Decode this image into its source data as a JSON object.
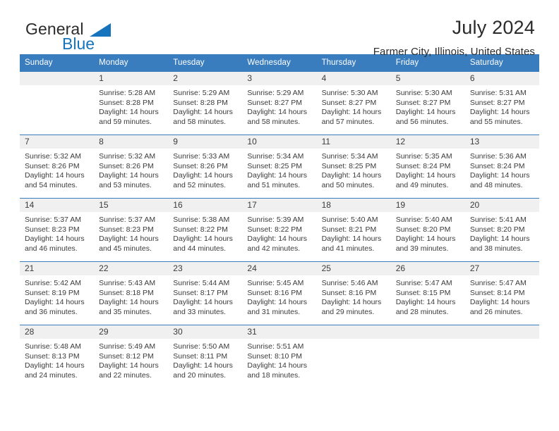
{
  "brand": {
    "name_part1": "General",
    "name_part2": "Blue",
    "accent_color": "#1574bb"
  },
  "header": {
    "title": "July 2024",
    "location": "Farmer City, Illinois, United States"
  },
  "theme": {
    "header_row_color": "#3a7dbf",
    "daynum_band_color": "#f0f0f0",
    "text_color": "#3b3b3b"
  },
  "weekday_headers": [
    "Sunday",
    "Monday",
    "Tuesday",
    "Wednesday",
    "Thursday",
    "Friday",
    "Saturday"
  ],
  "weeks": [
    [
      {
        "day": "",
        "sunrise": "",
        "sunset": "",
        "daylight_line1": "",
        "daylight_line2": ""
      },
      {
        "day": "1",
        "sunrise": "Sunrise: 5:28 AM",
        "sunset": "Sunset: 8:28 PM",
        "daylight_line1": "Daylight: 14 hours",
        "daylight_line2": "and 59 minutes."
      },
      {
        "day": "2",
        "sunrise": "Sunrise: 5:29 AM",
        "sunset": "Sunset: 8:28 PM",
        "daylight_line1": "Daylight: 14 hours",
        "daylight_line2": "and 58 minutes."
      },
      {
        "day": "3",
        "sunrise": "Sunrise: 5:29 AM",
        "sunset": "Sunset: 8:27 PM",
        "daylight_line1": "Daylight: 14 hours",
        "daylight_line2": "and 58 minutes."
      },
      {
        "day": "4",
        "sunrise": "Sunrise: 5:30 AM",
        "sunset": "Sunset: 8:27 PM",
        "daylight_line1": "Daylight: 14 hours",
        "daylight_line2": "and 57 minutes."
      },
      {
        "day": "5",
        "sunrise": "Sunrise: 5:30 AM",
        "sunset": "Sunset: 8:27 PM",
        "daylight_line1": "Daylight: 14 hours",
        "daylight_line2": "and 56 minutes."
      },
      {
        "day": "6",
        "sunrise": "Sunrise: 5:31 AM",
        "sunset": "Sunset: 8:27 PM",
        "daylight_line1": "Daylight: 14 hours",
        "daylight_line2": "and 55 minutes."
      }
    ],
    [
      {
        "day": "7",
        "sunrise": "Sunrise: 5:32 AM",
        "sunset": "Sunset: 8:26 PM",
        "daylight_line1": "Daylight: 14 hours",
        "daylight_line2": "and 54 minutes."
      },
      {
        "day": "8",
        "sunrise": "Sunrise: 5:32 AM",
        "sunset": "Sunset: 8:26 PM",
        "daylight_line1": "Daylight: 14 hours",
        "daylight_line2": "and 53 minutes."
      },
      {
        "day": "9",
        "sunrise": "Sunrise: 5:33 AM",
        "sunset": "Sunset: 8:26 PM",
        "daylight_line1": "Daylight: 14 hours",
        "daylight_line2": "and 52 minutes."
      },
      {
        "day": "10",
        "sunrise": "Sunrise: 5:34 AM",
        "sunset": "Sunset: 8:25 PM",
        "daylight_line1": "Daylight: 14 hours",
        "daylight_line2": "and 51 minutes."
      },
      {
        "day": "11",
        "sunrise": "Sunrise: 5:34 AM",
        "sunset": "Sunset: 8:25 PM",
        "daylight_line1": "Daylight: 14 hours",
        "daylight_line2": "and 50 minutes."
      },
      {
        "day": "12",
        "sunrise": "Sunrise: 5:35 AM",
        "sunset": "Sunset: 8:24 PM",
        "daylight_line1": "Daylight: 14 hours",
        "daylight_line2": "and 49 minutes."
      },
      {
        "day": "13",
        "sunrise": "Sunrise: 5:36 AM",
        "sunset": "Sunset: 8:24 PM",
        "daylight_line1": "Daylight: 14 hours",
        "daylight_line2": "and 48 minutes."
      }
    ],
    [
      {
        "day": "14",
        "sunrise": "Sunrise: 5:37 AM",
        "sunset": "Sunset: 8:23 PM",
        "daylight_line1": "Daylight: 14 hours",
        "daylight_line2": "and 46 minutes."
      },
      {
        "day": "15",
        "sunrise": "Sunrise: 5:37 AM",
        "sunset": "Sunset: 8:23 PM",
        "daylight_line1": "Daylight: 14 hours",
        "daylight_line2": "and 45 minutes."
      },
      {
        "day": "16",
        "sunrise": "Sunrise: 5:38 AM",
        "sunset": "Sunset: 8:22 PM",
        "daylight_line1": "Daylight: 14 hours",
        "daylight_line2": "and 44 minutes."
      },
      {
        "day": "17",
        "sunrise": "Sunrise: 5:39 AM",
        "sunset": "Sunset: 8:22 PM",
        "daylight_line1": "Daylight: 14 hours",
        "daylight_line2": "and 42 minutes."
      },
      {
        "day": "18",
        "sunrise": "Sunrise: 5:40 AM",
        "sunset": "Sunset: 8:21 PM",
        "daylight_line1": "Daylight: 14 hours",
        "daylight_line2": "and 41 minutes."
      },
      {
        "day": "19",
        "sunrise": "Sunrise: 5:40 AM",
        "sunset": "Sunset: 8:20 PM",
        "daylight_line1": "Daylight: 14 hours",
        "daylight_line2": "and 39 minutes."
      },
      {
        "day": "20",
        "sunrise": "Sunrise: 5:41 AM",
        "sunset": "Sunset: 8:20 PM",
        "daylight_line1": "Daylight: 14 hours",
        "daylight_line2": "and 38 minutes."
      }
    ],
    [
      {
        "day": "21",
        "sunrise": "Sunrise: 5:42 AM",
        "sunset": "Sunset: 8:19 PM",
        "daylight_line1": "Daylight: 14 hours",
        "daylight_line2": "and 36 minutes."
      },
      {
        "day": "22",
        "sunrise": "Sunrise: 5:43 AM",
        "sunset": "Sunset: 8:18 PM",
        "daylight_line1": "Daylight: 14 hours",
        "daylight_line2": "and 35 minutes."
      },
      {
        "day": "23",
        "sunrise": "Sunrise: 5:44 AM",
        "sunset": "Sunset: 8:17 PM",
        "daylight_line1": "Daylight: 14 hours",
        "daylight_line2": "and 33 minutes."
      },
      {
        "day": "24",
        "sunrise": "Sunrise: 5:45 AM",
        "sunset": "Sunset: 8:16 PM",
        "daylight_line1": "Daylight: 14 hours",
        "daylight_line2": "and 31 minutes."
      },
      {
        "day": "25",
        "sunrise": "Sunrise: 5:46 AM",
        "sunset": "Sunset: 8:16 PM",
        "daylight_line1": "Daylight: 14 hours",
        "daylight_line2": "and 29 minutes."
      },
      {
        "day": "26",
        "sunrise": "Sunrise: 5:47 AM",
        "sunset": "Sunset: 8:15 PM",
        "daylight_line1": "Daylight: 14 hours",
        "daylight_line2": "and 28 minutes."
      },
      {
        "day": "27",
        "sunrise": "Sunrise: 5:47 AM",
        "sunset": "Sunset: 8:14 PM",
        "daylight_line1": "Daylight: 14 hours",
        "daylight_line2": "and 26 minutes."
      }
    ],
    [
      {
        "day": "28",
        "sunrise": "Sunrise: 5:48 AM",
        "sunset": "Sunset: 8:13 PM",
        "daylight_line1": "Daylight: 14 hours",
        "daylight_line2": "and 24 minutes."
      },
      {
        "day": "29",
        "sunrise": "Sunrise: 5:49 AM",
        "sunset": "Sunset: 8:12 PM",
        "daylight_line1": "Daylight: 14 hours",
        "daylight_line2": "and 22 minutes."
      },
      {
        "day": "30",
        "sunrise": "Sunrise: 5:50 AM",
        "sunset": "Sunset: 8:11 PM",
        "daylight_line1": "Daylight: 14 hours",
        "daylight_line2": "and 20 minutes."
      },
      {
        "day": "31",
        "sunrise": "Sunrise: 5:51 AM",
        "sunset": "Sunset: 8:10 PM",
        "daylight_line1": "Daylight: 14 hours",
        "daylight_line2": "and 18 minutes."
      },
      {
        "day": "",
        "sunrise": "",
        "sunset": "",
        "daylight_line1": "",
        "daylight_line2": ""
      },
      {
        "day": "",
        "sunrise": "",
        "sunset": "",
        "daylight_line1": "",
        "daylight_line2": ""
      },
      {
        "day": "",
        "sunrise": "",
        "sunset": "",
        "daylight_line1": "",
        "daylight_line2": ""
      }
    ]
  ]
}
